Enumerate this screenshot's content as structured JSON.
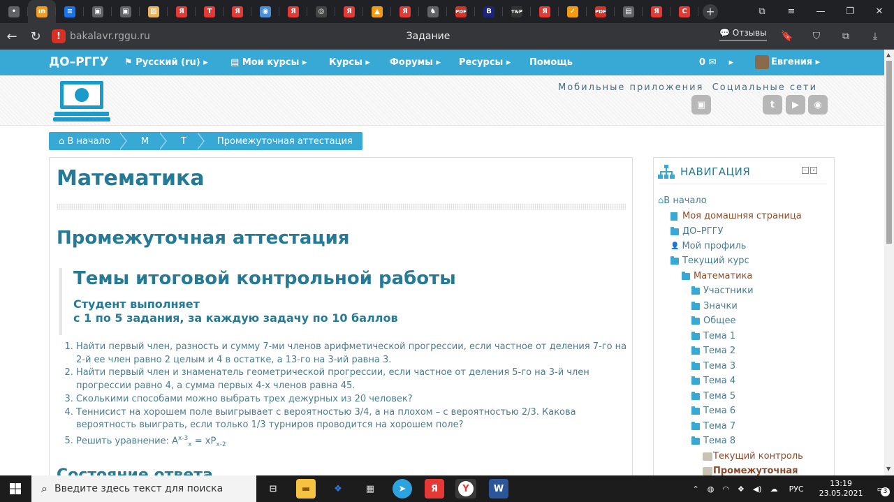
{
  "browser": {
    "tabs": [
      {
        "icon": "generic-icon",
        "color": "#5f6368",
        "glyph": "•"
      },
      {
        "icon": "orange-site-icon",
        "color": "#f29b1d",
        "glyph": "ın"
      },
      {
        "icon": "media-icon",
        "color": "#1a73e8",
        "glyph": "≡"
      },
      {
        "icon": "save-icon",
        "color": "#5f6368",
        "glyph": "▣"
      },
      {
        "icon": "save-icon",
        "color": "#5f6368",
        "glyph": "▣"
      },
      {
        "icon": "image-icon",
        "color": "#e8b55c",
        "glyph": "▨"
      },
      {
        "icon": "yandex-icon",
        "color": "#e53935",
        "glyph": "Я"
      },
      {
        "icon": "t-icon",
        "color": "#e53935",
        "glyph": "T"
      },
      {
        "icon": "yandex-icon",
        "color": "#e53935",
        "glyph": "Я"
      },
      {
        "icon": "blue-app-icon",
        "color": "#4a90d9",
        "glyph": "◉"
      },
      {
        "icon": "yandex-icon",
        "color": "#e53935",
        "glyph": "Я"
      },
      {
        "icon": "mask-icon",
        "color": "#444",
        "glyph": "◎"
      },
      {
        "icon": "yandex-icon",
        "color": "#e53935",
        "glyph": "Я"
      },
      {
        "icon": "orange-bag-icon",
        "color": "#f39c12",
        "glyph": "▲"
      },
      {
        "icon": "yandex-icon",
        "color": "#e53935",
        "glyph": "Я"
      },
      {
        "icon": "chess-icon",
        "color": "#5f6368",
        "glyph": "♞"
      },
      {
        "icon": "pdf-icon",
        "color": "#d93025",
        "glyph": "PDF"
      },
      {
        "icon": "b-icon",
        "color": "#1a237e",
        "glyph": "B"
      },
      {
        "icon": "tp-icon",
        "color": "#333",
        "glyph": "T&P"
      },
      {
        "icon": "yandex-icon",
        "color": "#e53935",
        "glyph": "Я"
      },
      {
        "icon": "check-icon",
        "color": "#f39c12",
        "glyph": "✓"
      },
      {
        "icon": "pdf-icon",
        "color": "#d93025",
        "glyph": "PDF"
      },
      {
        "icon": "doc-icon",
        "color": "#5f6368",
        "glyph": "▤"
      },
      {
        "icon": "yandex-icon",
        "color": "#e53935",
        "glyph": "Я"
      },
      {
        "icon": "c-icon",
        "color": "#e53935",
        "glyph": "C"
      }
    ],
    "url": "bakalavr.rggu.ru",
    "page_title": "Задание",
    "reviews_label": "Отзывы"
  },
  "site": {
    "brand": "ДО–РГГУ",
    "nav": [
      {
        "label": "Русский (ru)",
        "x": 0
      },
      {
        "label": "Мои курсы"
      },
      {
        "label": "Курсы"
      },
      {
        "label": "Форумы"
      },
      {
        "label": "Ресурсы"
      },
      {
        "label": "Помощь"
      }
    ],
    "messages_count": "0",
    "user": "Евгения",
    "mobile_apps": "Мобильные приложения",
    "social_networks": "Социальные сети"
  },
  "breadcrumb": [
    "В начало",
    "М",
    "Т",
    "Промежуточная аттестация"
  ],
  "main": {
    "course_title": "Математика",
    "section_title": "Промежуточная аттестация",
    "block_title": "Темы итоговой контрольной работы",
    "subtitle_line1": "Студент выполняет",
    "subtitle_line2": "с 1 по 5 задания, за каждую задачу по 10 баллов",
    "tasks": [
      "Найти первый член, разность и сумму 7-ми членов арифметической прогрессии, если частное от деления 7-го на 2-й ее член равно 2 целым и 4 в остатке, а 13-го на 3-ий равна 3.",
      "Найти первый член и знаменатель геометрической прогрессии, если  частное от деления 5-го на 3-й член прогрессии равно 4, а сумма первых 4-х членов равна 45.",
      "Сколькими способами можно выбрать трех дежурных из 20 человек?",
      "Теннисист на хорошем поле выигрывает с вероятностью 3/4, а на плохом – с вероятностью 2/3. Какова вероятность выиграть, если только 1/3 турниров проводится на хорошем поле?"
    ],
    "task5_prefix": "Решить уравнение: A",
    "task5_sup": "x-3",
    "task5_sub": "x",
    "task5_mid": " = xP",
    "task5_sub2": "x-2",
    "next_heading": "Состояние ответа"
  },
  "navigation": {
    "title": "НАВИГАЦИЯ",
    "items": [
      {
        "label": "В начало",
        "kind": "home"
      },
      {
        "label": "Моя домашняя страница",
        "kind": "doc"
      },
      {
        "label": "ДО–РГГУ",
        "kind": "folder"
      },
      {
        "label": "Мой профиль",
        "kind": "user"
      },
      {
        "label": "Текущий курс",
        "kind": "folder-open"
      },
      {
        "label": "Математика",
        "kind": "folder-open"
      },
      {
        "label": "Участники",
        "kind": "folder"
      },
      {
        "label": "Значки",
        "kind": "folder"
      },
      {
        "label": "Общее",
        "kind": "folder"
      },
      {
        "label": "Тема 1",
        "kind": "folder"
      },
      {
        "label": "Тема 2",
        "kind": "folder"
      },
      {
        "label": "Тема 3",
        "kind": "folder"
      },
      {
        "label": "Тема 4",
        "kind": "folder"
      },
      {
        "label": "Тема 5",
        "kind": "folder"
      },
      {
        "label": "Тема 6",
        "kind": "folder"
      },
      {
        "label": "Тема 7",
        "kind": "folder"
      },
      {
        "label": "Тема 8",
        "kind": "folder-open"
      },
      {
        "label": "Текущий контроль",
        "kind": "quiz"
      },
      {
        "label": "Промежуточная",
        "kind": "quiz-bold"
      }
    ]
  },
  "taskbar": {
    "search_placeholder": "Введите здесь текст для поиска",
    "language": "РУС",
    "time": "13:19",
    "date": "23.05.2021",
    "notifications": "3"
  }
}
